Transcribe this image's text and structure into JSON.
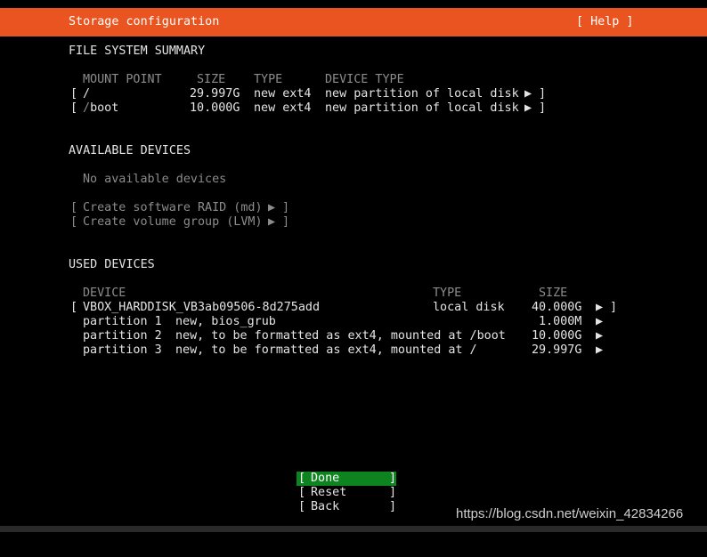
{
  "header": {
    "title": "Storage configuration",
    "help": "[ Help ]"
  },
  "fs_summary": {
    "heading": "FILE SYSTEM SUMMARY",
    "columns": [
      "MOUNT POINT",
      "SIZE",
      "TYPE",
      "DEVICE TYPE"
    ],
    "rows": [
      {
        "open": "[",
        "mount_prefix": "",
        "mount": "/",
        "size": "29.997G",
        "type": "new ext4",
        "device_type": "new partition of local disk",
        "arrow": "▶",
        "close": "]"
      },
      {
        "open": "[",
        "mount_prefix": "/",
        "mount": "boot",
        "size": "10.000G",
        "type": "new ext4",
        "device_type": "new partition of local disk",
        "arrow": "▶",
        "close": "]"
      }
    ]
  },
  "available": {
    "heading": "AVAILABLE DEVICES",
    "empty_text": "No available devices",
    "actions": [
      {
        "open": "[",
        "label": "Create software RAID (md)",
        "arrow": "▶",
        "close": "]"
      },
      {
        "open": "[",
        "label": "Create volume group (LVM)",
        "arrow": "▶",
        "close": "]"
      }
    ]
  },
  "used": {
    "heading": "USED DEVICES",
    "columns": [
      "DEVICE",
      "TYPE",
      "SIZE"
    ],
    "disk": {
      "open": "[",
      "name": "VBOX_HARDDISK_VB3ab09506-8d275add",
      "type": "local disk",
      "size": "40.000G",
      "arrow": "▶",
      "close": "]"
    },
    "partitions": [
      {
        "name": "partition 1",
        "desc": "new, bios_grub",
        "size": "1.000M",
        "arrow": "▶"
      },
      {
        "name": "partition 2",
        "desc": "new, to be formatted as ext4, mounted at /boot",
        "size": "10.000G",
        "arrow": "▶"
      },
      {
        "name": "partition 3",
        "desc": "new, to be formatted as ext4, mounted at /",
        "size": "29.997G",
        "arrow": "▶"
      }
    ]
  },
  "buttons": [
    {
      "open": "[",
      "label": "Done",
      "close": "]",
      "focused": true
    },
    {
      "open": "[",
      "label": "Reset",
      "close": "]",
      "focused": false
    },
    {
      "open": "[",
      "label": "Back",
      "close": "]",
      "focused": false
    }
  ],
  "watermark": "https://blog.csdn.net/weixin_42834266",
  "colors": {
    "header": "#e95420",
    "focus": "#0e8420",
    "text": "#e4e4e4",
    "dim": "#8c8c8c",
    "background": "#000000"
  }
}
